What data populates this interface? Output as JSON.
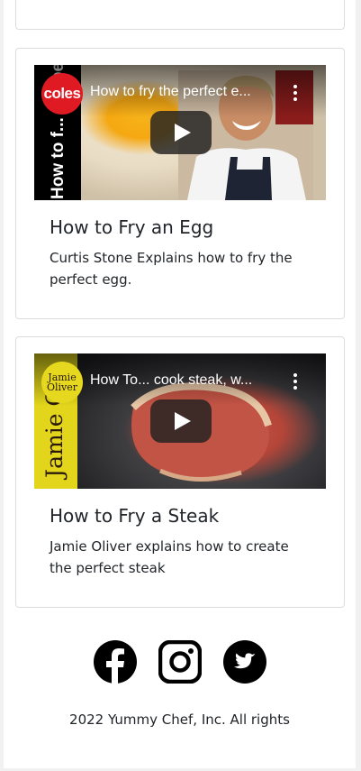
{
  "videos": [
    {
      "video_title": "How to fry the perfect e...",
      "channel_logo_text": "coles",
      "thumbnail_side_text": "How to f... the perfect",
      "card_title": "How to Fry an Egg",
      "card_text": "Curtis Stone Explains how to fry the perfect egg."
    },
    {
      "video_title": "How To... cook steak, w...",
      "channel_logo_text": "Jamie Oliver",
      "thumbnail_side_text": "Jamie O",
      "card_title": "How to Fry a Steak",
      "card_text": "Jamie Oliver explains how to create the perfect steak"
    }
  ],
  "social": {
    "icons": [
      "facebook-icon",
      "instagram-icon",
      "twitter-icon"
    ]
  },
  "footer": {
    "copyright": "2022 Yummy Chef, Inc. All rights"
  },
  "colors": {
    "background": "#ffffff",
    "card_border": "#dcdcdc",
    "text": "#212529",
    "icon": "#000000"
  }
}
